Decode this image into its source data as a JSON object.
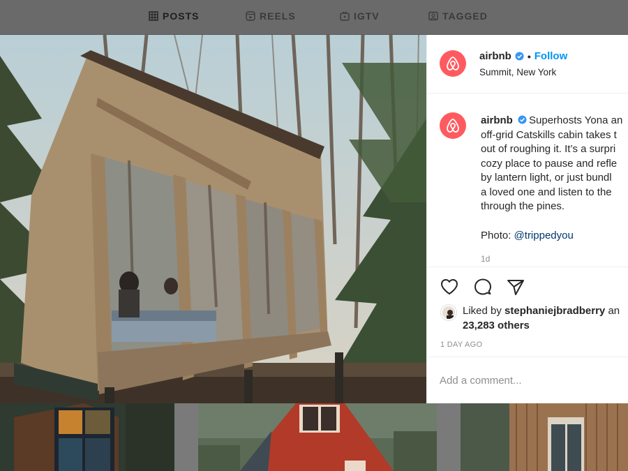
{
  "tabs": [
    {
      "label": "POSTS",
      "icon": "grid-icon",
      "active": true
    },
    {
      "label": "REELS",
      "icon": "reels-icon",
      "active": false
    },
    {
      "label": "IGTV",
      "icon": "igtv-icon",
      "active": false
    },
    {
      "label": "TAGGED",
      "icon": "tagged-icon",
      "active": false
    }
  ],
  "post": {
    "username": "airbnb",
    "verified": true,
    "separator": "•",
    "follow_label": "Follow",
    "location": "Summit, New York",
    "caption_username": "airbnb",
    "caption_lines": [
      "Superhosts Yona an",
      "off-grid Catskills cabin takes t",
      "out of roughing it. It’s a surpri",
      "cozy place to pause and refle",
      "by lantern light, or just bundl",
      "a loved one and listen to the",
      "through the pines."
    ],
    "photo_label": "Photo:",
    "photo_mention": "@trippedyou",
    "time_ago": "1d",
    "liked_by_prefix": "Liked by",
    "liked_by_user": "stephaniejbradberry",
    "liked_by_suffix": "an",
    "others_count": "23,283 others",
    "date": "1 DAY AGO",
    "comment_placeholder": "Add a comment..."
  },
  "colors": {
    "brand": "#ff5a5f",
    "link": "#0095f6",
    "verified": "#3897f0"
  }
}
